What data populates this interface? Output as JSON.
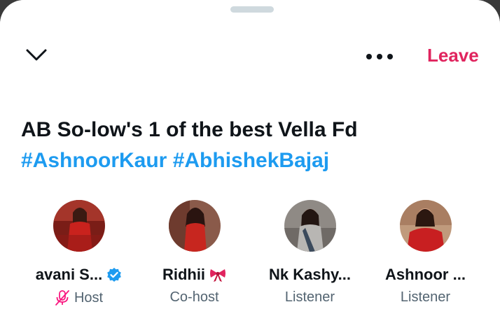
{
  "header": {
    "more_label": "More options",
    "leave_label": "Leave"
  },
  "space": {
    "title_line1": "AB So-low's 1 of the best Vella Fd",
    "title_hashtags": "#AshnoorKaur #AbhishekBajaj"
  },
  "participants": [
    {
      "name": "avani S...",
      "role": "Host",
      "verified": true,
      "muted": true,
      "avatar_icon": "avatar-red-outfit"
    },
    {
      "name": "Ridhii",
      "role": "Co-host",
      "badge": "bow-icon",
      "avatar_icon": "avatar-red-dress"
    },
    {
      "name": "Nk Kashy...",
      "role": "Listener",
      "avatar_icon": "avatar-grey-saree"
    },
    {
      "name": "Ashnoor ...",
      "role": "Listener",
      "avatar_icon": "avatar-red-top"
    }
  ],
  "colors": {
    "accent_blue": "#1d9bf0",
    "leave_red": "#e0245e",
    "text_primary": "#0f1419",
    "text_secondary": "#536471",
    "muted_mic": "#f91880",
    "backdrop": "#3a3a3a"
  }
}
